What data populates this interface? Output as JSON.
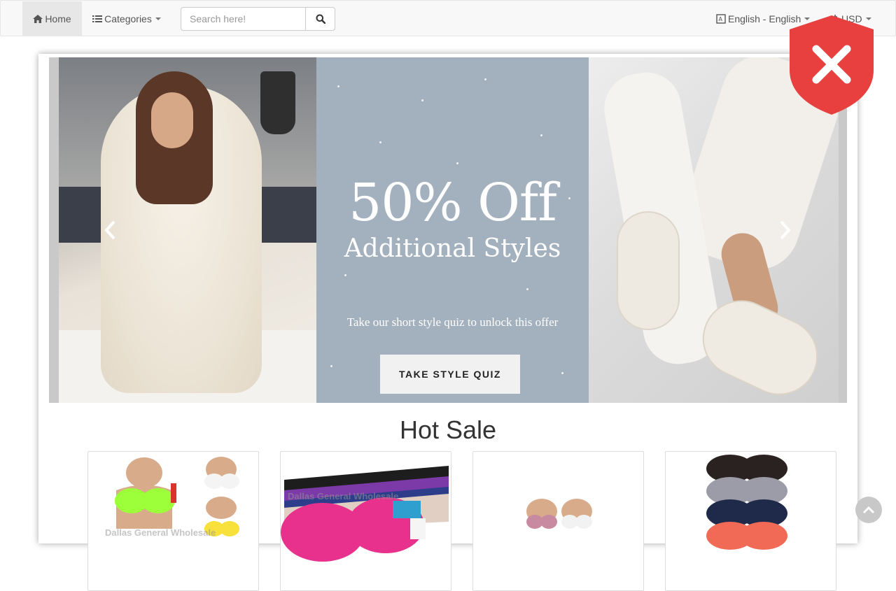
{
  "navbar": {
    "home_label": "Home",
    "home_icon": "home-icon",
    "categories_label": "Categories",
    "categories_icon": "list-icon",
    "search_placeholder": "Search here!",
    "search_icon": "search-icon",
    "language_label": "English - English",
    "language_icon": "language-icon",
    "currency_label": "USD",
    "currency_icon": "currency-icon"
  },
  "security_badge": {
    "icon": "shield-x-icon",
    "color": "#e8403f"
  },
  "carousel": {
    "promo_headline": "50% Off",
    "promo_subheadline": "Additional Styles",
    "promo_note": "Take our short style quiz to unlock this offer",
    "cta_label": "TAKE STYLE QUIZ",
    "prev_icon": "chevron-left-icon",
    "next_icon": "chevron-right-icon",
    "promo_bg_color": "#a3b0bd"
  },
  "hot_sale": {
    "title": "Hot Sale",
    "watermark": "Dallas General Wholesale",
    "products": [
      {
        "image": "bra-product-photo-1"
      },
      {
        "image": "bra-product-photo-2"
      },
      {
        "image": "bra-product-photo-3"
      },
      {
        "image": "bra-product-photo-4"
      }
    ]
  },
  "back_to_top_icon": "arrow-up-icon"
}
